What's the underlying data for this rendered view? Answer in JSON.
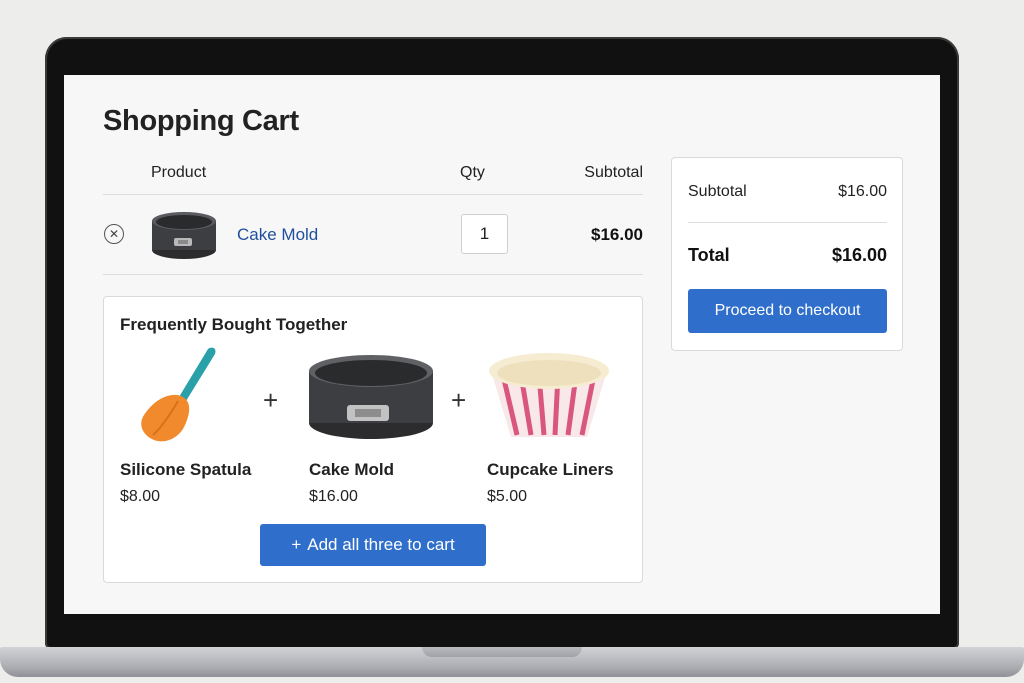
{
  "page": {
    "title": "Shopping Cart"
  },
  "cart": {
    "headers": {
      "product": "Product",
      "qty": "Qty",
      "subtotal": "Subtotal"
    },
    "items": [
      {
        "name": "Cake Mold",
        "qty": "1",
        "subtotal": "$16.00",
        "image": "springform-pan-icon",
        "remove_icon": "close-circle-icon"
      }
    ]
  },
  "fbt": {
    "title": "Frequently Bought Together",
    "items": [
      {
        "name": "Silicone Spatula",
        "price": "$8.00",
        "image": "spatula-icon"
      },
      {
        "name": "Cake Mold",
        "price": "$16.00",
        "image": "springform-pan-icon"
      },
      {
        "name": "Cupcake Liners",
        "price": "$5.00",
        "image": "cupcake-liner-icon"
      }
    ],
    "separator": "+",
    "add_all_label": "Add all three to cart",
    "add_all_icon": "+"
  },
  "summary": {
    "subtotal_label": "Subtotal",
    "subtotal_value": "$16.00",
    "total_label": "Total",
    "total_value": "$16.00",
    "checkout_label": "Proceed to checkout"
  },
  "colors": {
    "accent": "#2f6fcb",
    "link": "#1f4f9e"
  }
}
